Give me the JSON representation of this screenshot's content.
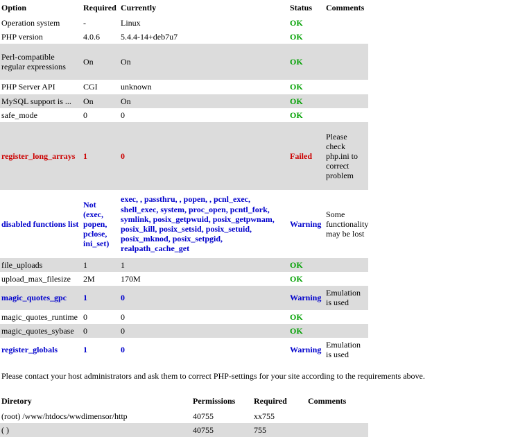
{
  "requirements_table": {
    "columns": [
      "Option",
      "Required",
      "Currently",
      "Status",
      "Comments"
    ],
    "status_colors": {
      "ok": "#00a000",
      "failed": "#cc0000",
      "warning": "#0000cc"
    },
    "row_background_alt": "#dcdcdc",
    "rows": [
      {
        "option": "Operation system",
        "required": "-",
        "currently": "Linux",
        "status": "OK",
        "comments": "",
        "severity": "ok",
        "shaded": false
      },
      {
        "option": "PHP version",
        "required": "4.0.6",
        "currently": "5.4.4-14+deb7u7",
        "status": "OK",
        "comments": "",
        "severity": "ok",
        "shaded": false
      },
      {
        "option": "Perl-compatible regular expressions",
        "required": "On",
        "currently": "On",
        "status": "OK",
        "comments": "",
        "severity": "ok",
        "shaded": true
      },
      {
        "option": "PHP Server API",
        "required": "CGI",
        "currently": "unknown",
        "status": "OK",
        "comments": "",
        "severity": "ok",
        "shaded": false
      },
      {
        "option": "MySQL support is ...",
        "required": "On",
        "currently": "On",
        "status": "OK",
        "comments": "",
        "severity": "ok",
        "shaded": true
      },
      {
        "option": "safe_mode",
        "required": "0",
        "currently": "0",
        "status": "OK",
        "comments": "",
        "severity": "ok",
        "shaded": false
      },
      {
        "option": "register_long_arrays",
        "required": "1",
        "currently": "0",
        "status": "Failed",
        "comments": "Please check php.ini to correct problem",
        "severity": "failed",
        "shaded": true
      },
      {
        "option": "disabled functions list",
        "required": "Not (exec, popen, pclose, ini_set)",
        "currently": "exec, , passthru, , popen, , pcnl_exec, shell_exec, system, proc_open, pcntl_fork, symlink, posix_getpwuid, posix_getpwnam, posix_kill, posix_setsid, posix_setuid, posix_mknod, posix_setpgid, realpath_cache_get",
        "status": "Warning",
        "comments": "Some functionality may be lost",
        "severity": "warning",
        "shaded": false
      },
      {
        "option": "file_uploads",
        "required": "1",
        "currently": "1",
        "status": "OK",
        "comments": "",
        "severity": "ok",
        "shaded": true
      },
      {
        "option": "upload_max_filesize",
        "required": "2M",
        "currently": "170M",
        "status": "OK",
        "comments": "",
        "severity": "ok",
        "shaded": false
      },
      {
        "option": "magic_quotes_gpc",
        "required": "1",
        "currently": "0",
        "status": "Warning",
        "comments": "Emulation is used",
        "severity": "warning",
        "shaded": true
      },
      {
        "option": "magic_quotes_runtime",
        "required": "0",
        "currently": "0",
        "status": "OK",
        "comments": "",
        "severity": "ok",
        "shaded": false
      },
      {
        "option": "magic_quotes_sybase",
        "required": "0",
        "currently": "0",
        "status": "OK",
        "comments": "",
        "severity": "ok",
        "shaded": true
      },
      {
        "option": "register_globals",
        "required": "1",
        "currently": "0",
        "status": "Warning",
        "comments": "Emulation is used",
        "severity": "warning",
        "shaded": false
      }
    ]
  },
  "notice": "Please contact your host administrators and ask them to correct PHP-settings for your site according to the requirements above.",
  "directories_table": {
    "columns": [
      "Diretory",
      "Permissions",
      "Required",
      "Comments"
    ],
    "rows": [
      {
        "directory": "(root) /www/htdocs/wwdimensor/http",
        "permissions": "40755",
        "required": "xx755",
        "comments": "",
        "shaded": false
      },
      {
        "directory": "(  )",
        "permissions": "40755",
        "required": "755",
        "comments": "",
        "shaded": true
      }
    ]
  }
}
